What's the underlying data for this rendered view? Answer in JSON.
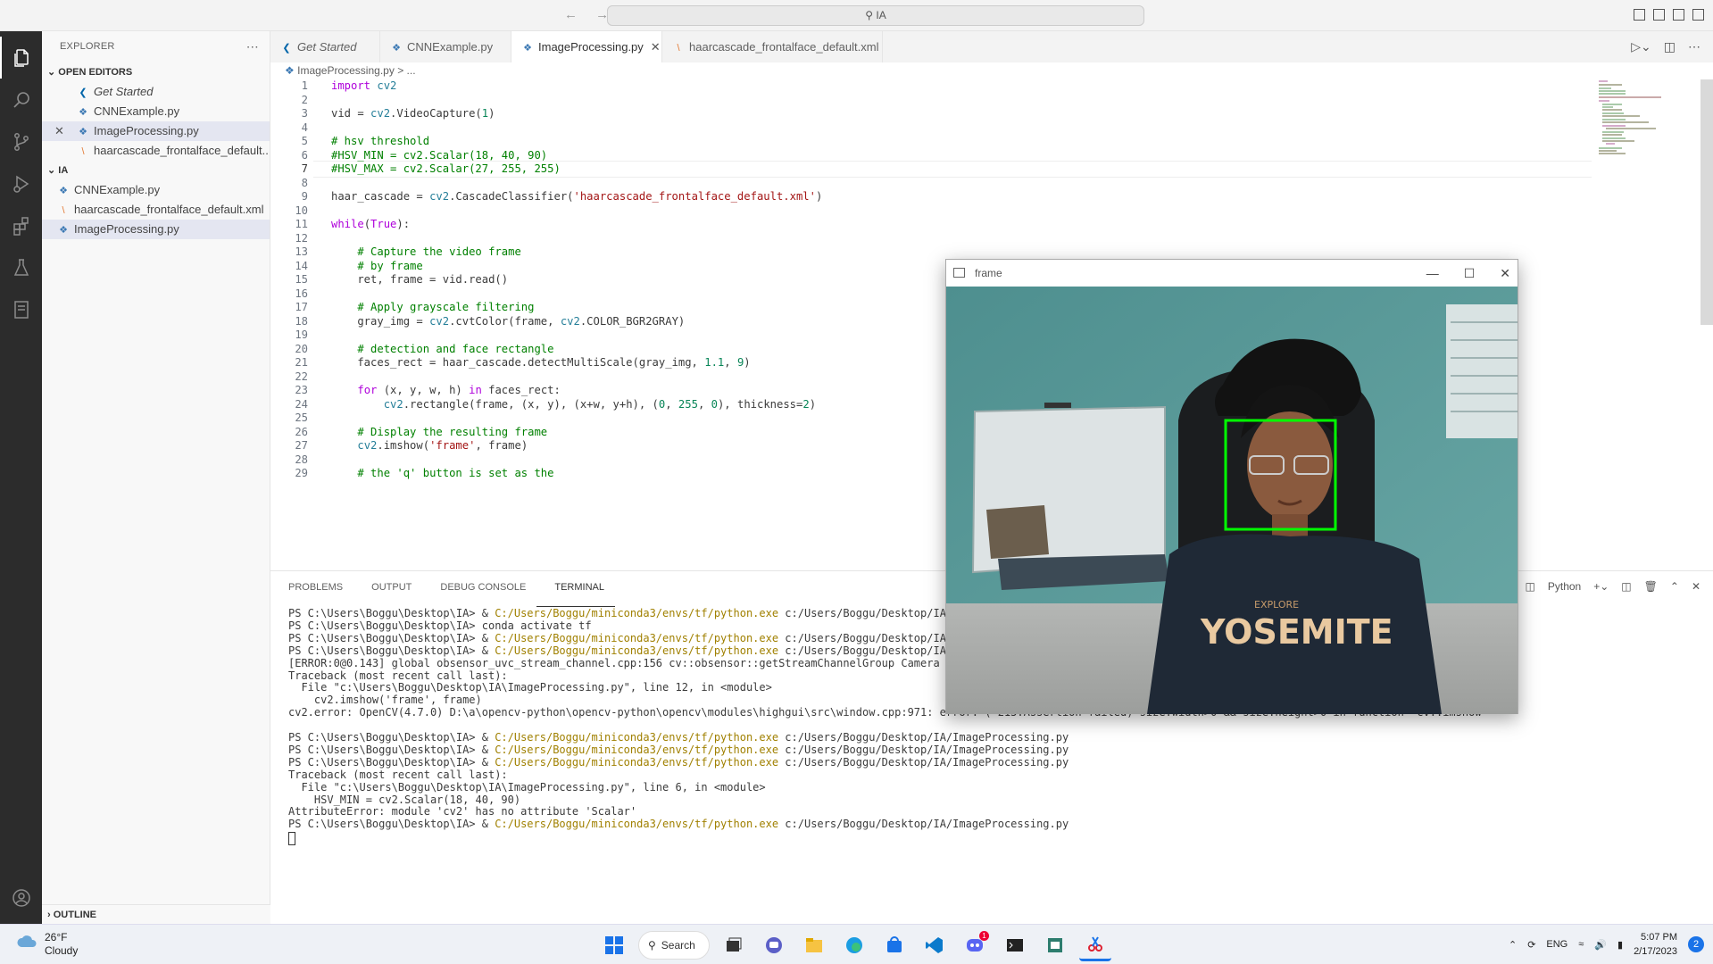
{
  "titlebar": {
    "search_text": "IA",
    "nav_back": "←",
    "nav_forward": "→"
  },
  "activity_bar": {
    "items": [
      "explorer-icon",
      "search-icon",
      "source-control-icon",
      "run-debug-icon",
      "extensions-icon",
      "testing-icon",
      "notebook-icon"
    ],
    "bottom": [
      "account-icon",
      "settings-icon"
    ]
  },
  "sidebar": {
    "title": "EXPLORER",
    "more": "⋯",
    "open_editors_label": "OPEN EDITORS",
    "open_editors": [
      {
        "label": "Get Started",
        "kind": "vscode",
        "italic": true
      },
      {
        "label": "CNNExample.py",
        "kind": "py"
      },
      {
        "label": "ImageProcessing.py",
        "kind": "py",
        "selected": true,
        "close": "✕"
      },
      {
        "label": "haarcascade_frontalface_default...",
        "kind": "xml"
      }
    ],
    "folder_label": "IA",
    "files": [
      {
        "label": "CNNExample.py",
        "kind": "py"
      },
      {
        "label": "haarcascade_frontalface_default.xml",
        "kind": "xml"
      },
      {
        "label": "ImageProcessing.py",
        "kind": "py",
        "selected": true
      }
    ],
    "outline_label": "OUTLINE"
  },
  "tabs": [
    {
      "label": "Get Started",
      "kind": "vscode",
      "italic": true
    },
    {
      "label": "CNNExample.py",
      "kind": "py"
    },
    {
      "label": "ImageProcessing.py",
      "kind": "py",
      "active": true,
      "close": "✕"
    },
    {
      "label": "haarcascade_frontalface_default.xml",
      "kind": "xml"
    }
  ],
  "breadcrumb": {
    "file": "ImageProcessing.py",
    "rest": "> ..."
  },
  "code_lines": [
    "import cv2",
    "",
    "vid = cv2.VideoCapture(1)",
    "",
    "# hsv threshold",
    "#HSV_MIN = cv2.Scalar(18, 40, 90)",
    "#HSV_MAX = cv2.Scalar(27, 255, 255)",
    "",
    "haar_cascade = cv2.CascadeClassifier('haarcascade_frontalface_default.xml')",
    "",
    "while(True):",
    "",
    "    # Capture the video frame",
    "    # by frame",
    "    ret, frame = vid.read()",
    "",
    "    # Apply grayscale filtering",
    "    gray_img = cv2.cvtColor(frame, cv2.COLOR_BGR2GRAY)",
    "",
    "    # detection and face rectangle",
    "    faces_rect = haar_cascade.detectMultiScale(gray_img, 1.1, 9)",
    "",
    "    for (x, y, w, h) in faces_rect:",
    "        cv2.rectangle(frame, (x, y), (x+w, y+h), (0, 255, 0), thickness=2)",
    "",
    "    # Display the resulting frame",
    "    cv2.imshow('frame', frame)",
    "",
    "    # the 'q' button is set as the"
  ],
  "panel": {
    "tabs": [
      "PROBLEMS",
      "OUTPUT",
      "DEBUG CONSOLE",
      "TERMINAL"
    ],
    "active_tab": "TERMINAL",
    "shell_label": "Python",
    "terminal_lines": [
      "PS C:\\Users\\Boggu\\Desktop\\IA> & C:/Users/Boggu/miniconda3/envs/tf/python.exe c:/Users/Boggu/Desktop/IA/Im",
      "PS C:\\Users\\Boggu\\Desktop\\IA> conda activate tf",
      "PS C:\\Users\\Boggu\\Desktop\\IA> & C:/Users/Boggu/miniconda3/envs/tf/python.exe c:/Users/Boggu/Desktop/IA/Im",
      "PS C:\\Users\\Boggu\\Desktop\\IA> & C:/Users/Boggu/miniconda3/envs/tf/python.exe c:/Users/Boggu/Desktop/IA/Im",
      "[ERROR:0@0.143] global obsensor_uvc_stream_channel.cpp:156 cv::obsensor::getStreamChannelGroup Camera ind",
      "Traceback (most recent call last):",
      "  File \"c:\\Users\\Boggu\\Desktop\\IA\\ImageProcessing.py\", line 12, in <module>",
      "    cv2.imshow('frame', frame)",
      "cv2.error: OpenCV(4.7.0) D:\\a\\opencv-python\\opencv-python\\opencv\\modules\\highgui\\src\\window.cpp:971: error: (-215:Assertion failed) size.width>0 && size.height>0 in function 'cv::imshow'",
      "",
      "PS C:\\Users\\Boggu\\Desktop\\IA> & C:/Users/Boggu/miniconda3/envs/tf/python.exe c:/Users/Boggu/Desktop/IA/ImageProcessing.py",
      "PS C:\\Users\\Boggu\\Desktop\\IA> & C:/Users/Boggu/miniconda3/envs/tf/python.exe c:/Users/Boggu/Desktop/IA/ImageProcessing.py",
      "PS C:\\Users\\Boggu\\Desktop\\IA> & C:/Users/Boggu/miniconda3/envs/tf/python.exe c:/Users/Boggu/Desktop/IA/ImageProcessing.py",
      "Traceback (most recent call last):",
      "  File \"c:\\Users\\Boggu\\Desktop\\IA\\ImageProcessing.py\", line 6, in <module>",
      "    HSV_MIN = cv2.Scalar(18, 40, 90)",
      "AttributeError: module 'cv2' has no attribute 'Scalar'",
      "PS C:\\Users\\Boggu\\Desktop\\IA> & C:/Users/Boggu/miniconda3/envs/tf/python.exe c:/Users/Boggu/Desktop/IA/ImageProcessing.py"
    ]
  },
  "cv_window": {
    "title": "frame",
    "minimize": "—",
    "maximize": "☐",
    "close": "✕",
    "shirt_text": "YOSEMITE",
    "shirt_small": "EXPLORE"
  },
  "taskbar": {
    "weather_temp": "26°F",
    "weather_desc": "Cloudy",
    "search_label": "Search",
    "apps": [
      "windows-start-icon",
      "search",
      "task-view-icon",
      "teams-chat-icon",
      "file-explorer-icon",
      "edge-icon",
      "store-icon",
      "vscode-icon",
      "discord-icon",
      "terminal-icon",
      "notepad-icon",
      "snipping-tool-icon"
    ],
    "discord_badge": "1",
    "tray_lang": "ENG",
    "time": "5:07 PM",
    "date": "2/17/2023",
    "notification_count": "2"
  },
  "colors": {
    "keyword": "#af00db",
    "function": "#795e26",
    "string": "#a31515",
    "comment": "#008000",
    "number": "#098658",
    "builtin": "#267f99",
    "face_box": "#00ff00",
    "terminal_path": "#a08000"
  }
}
